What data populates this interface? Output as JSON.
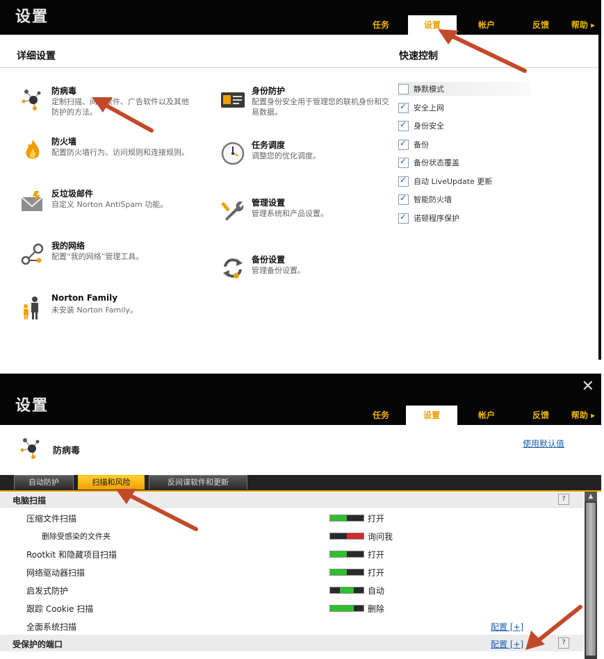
{
  "panel1": {
    "title": "设置",
    "tabs": [
      "任务",
      "设置",
      "帐户",
      "反馈",
      "帮助 ▸"
    ],
    "detail_heading": "详细设置",
    "quick_heading": "快速控制",
    "settings": [
      {
        "name": "防病毒",
        "desc": "定制扫描、间谍软件、广告软件以及其他防护的方法。",
        "icon": "virus-molecule-icon"
      },
      {
        "name": "身份防护",
        "desc": "配置身份安全用于管理您的联机身份和交易数据。",
        "icon": "id-card-icon"
      },
      {
        "name": "防火墙",
        "desc": "配置防火墙行为、访问规则和连接规则。",
        "icon": "flame-icon"
      },
      {
        "name": "任务调度",
        "desc": "调整您的优化调度。",
        "icon": "clock-icon"
      },
      {
        "name": "反垃圾邮件",
        "desc": "自定义 Norton AntiSpam 功能。",
        "icon": "envelope-icon"
      },
      {
        "name": "管理设置",
        "desc": "管理系统和产品设置。",
        "icon": "wrench-icon"
      },
      {
        "name": "我的网络",
        "desc": "配置“我的网络”管理工具。",
        "icon": "network-icon"
      },
      {
        "name": "备份设置",
        "desc": "管理备份设置。",
        "icon": "refresh-icon"
      },
      {
        "name": "Norton Family",
        "desc": "未安装 Norton Family。",
        "icon": "family-icon"
      }
    ],
    "quick_controls": [
      {
        "label": "静默模式",
        "checked": false
      },
      {
        "label": "安全上网",
        "checked": true
      },
      {
        "label": "身份安全",
        "checked": true
      },
      {
        "label": "备份",
        "checked": true
      },
      {
        "label": "备份状态覆盖",
        "checked": true
      },
      {
        "label": "自动 LiveUpdate 更新",
        "checked": true
      },
      {
        "label": "智能防火墙",
        "checked": true
      },
      {
        "label": "诺顿程序保护",
        "checked": true
      }
    ]
  },
  "panel2": {
    "title": "设置",
    "tabs": [
      "任务",
      "设置",
      "帐户",
      "反馈",
      "帮助 ▸"
    ],
    "section_title": "防病毒",
    "use_defaults": "使用默认值",
    "subtabs": [
      "自动防护",
      "扫描和风险",
      "反间谍软件和更新"
    ],
    "group1": "电脑扫描",
    "rows": [
      {
        "label": "压缩文件扫描",
        "state": "打开",
        "switch": "on"
      },
      {
        "label": "删除受感染的文件夹",
        "state": "询问我",
        "switch": "ask"
      },
      {
        "label": "Rootkit 和隐藏项目扫描",
        "state": "打开",
        "switch": "on"
      },
      {
        "label": "网络驱动器扫描",
        "state": "打开",
        "switch": "on"
      },
      {
        "label": "启发式防护",
        "state": "自动",
        "switch": "auto"
      },
      {
        "label": "跟踪 Cookie 扫描",
        "state": "删除",
        "switch": "delete"
      },
      {
        "label": "全面系统扫描",
        "config": "配置 [+]"
      }
    ],
    "group2": "受保护的端口",
    "group2_config": "配置 [+]",
    "help": "?"
  },
  "colors": {
    "accent": "#f0a000",
    "arrow": "#c24a2b",
    "on": "#2fbf2f",
    "off": "#d42a2a"
  }
}
